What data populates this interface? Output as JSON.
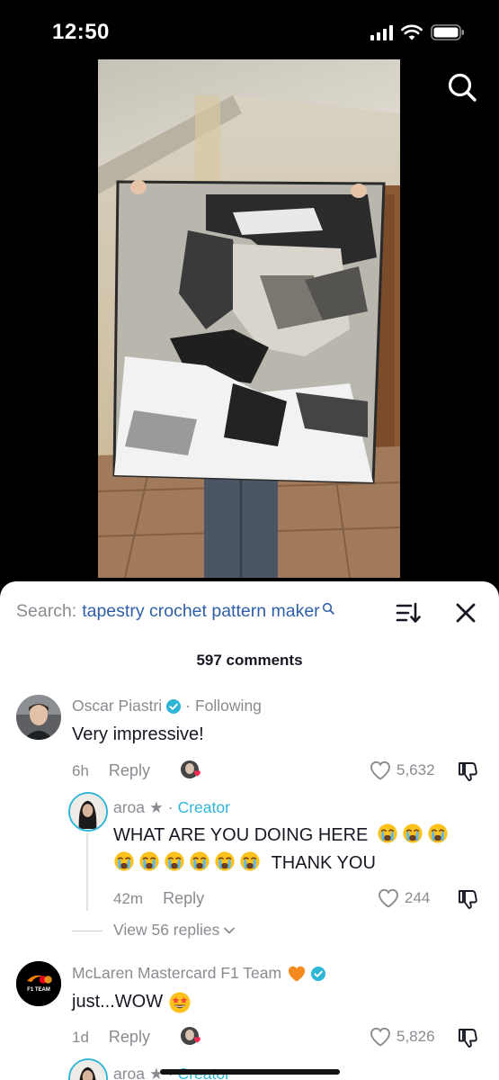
{
  "status_bar": {
    "time": "12:50"
  },
  "search": {
    "label": "Search:",
    "query": "tapestry crochet pattern maker"
  },
  "comments_header": {
    "count_label": "597 comments"
  },
  "comments": [
    {
      "author": "Oscar Piastri",
      "relation": "Following",
      "text": "Very impressive!",
      "time": "6h",
      "reply_label": "Reply",
      "likes": "5,632"
    },
    {
      "author": "aroa",
      "badge": "Creator",
      "text_line1": "WHAT ARE YOU DOING HERE",
      "text_line2": "THANK YOU",
      "time": "42m",
      "reply_label": "Reply",
      "likes": "244"
    },
    {
      "author": "McLaren Mastercard F1 Team",
      "text": "just...WOW",
      "time": "1d",
      "reply_label": "Reply",
      "likes": "5,826",
      "avatar_text": "F1 TEAM"
    },
    {
      "author": "aroa",
      "badge": "Creator"
    }
  ],
  "view_replies": "View 56 replies",
  "separator_dot": "·",
  "star": "★",
  "colors": {
    "accent": "#2fb6d6",
    "link": "#2f5fa8",
    "muted": "#8a8b91",
    "text": "#161823",
    "heart_badge": "#fe2c55"
  }
}
